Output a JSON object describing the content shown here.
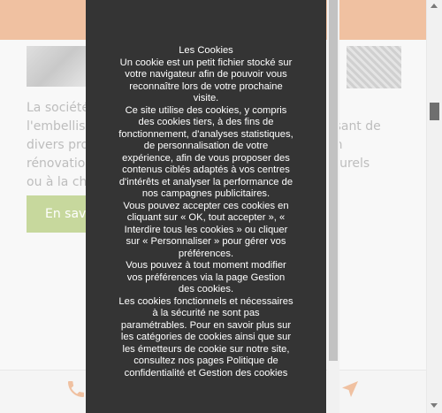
{
  "background_page": {
    "left_text_lines": [
      "La société",
      "l'embelliss",
      "divers pro",
      "rénovation",
      "ou à la cha"
    ],
    "right_text_lines": [
      "t",
      "osant de",
      "en",
      "aturels",
      ""
    ],
    "cta_label": "En savo",
    "icons": {
      "phone": "phone-icon",
      "navigation": "navigation-arrow-icon"
    },
    "colors": {
      "band": "#e8a06f",
      "cta": "#a9c469"
    }
  },
  "cookie_banner": {
    "title": "Les Cookies",
    "lines": [
      "Un cookie est un petit fichier stocké sur",
      "votre navigateur afin de pouvoir vous",
      "reconnaître lors de votre prochaine",
      "visite.",
      "Ce site utilise des cookies, y compris",
      "des cookies tiers, à des fins de",
      "fonctionnement, d'analyses statistiques,",
      "de personnalisation de votre",
      "expérience, afin de vous proposer des",
      "contenus ciblés adaptés à vos centres",
      "d'intérêts et analyser la performance de",
      "nos campagnes publicitaires.",
      "Vous pouvez accepter ces cookies en",
      "cliquant sur « OK, tout accepter », «",
      "Interdire tous les cookies  » ou cliquer",
      "sur « Personnaliser » pour gérer vos",
      "préférences.",
      "Vous pouvez à tout moment modifier",
      "vos préférences via la page Gestion",
      "des cookies.",
      "Les cookies fonctionnels et nécessaires",
      "à la sécurité ne sont pas",
      "paramétrables. Pour en savoir plus sur",
      "les catégories de cookies ainsi que sur",
      "les émetteurs de cookie sur notre site,",
      "consultez nos pages Politique de",
      "confidentialité et Gestion des cookies"
    ],
    "colors": {
      "panel": "#343434",
      "text": "#ffffff"
    }
  }
}
